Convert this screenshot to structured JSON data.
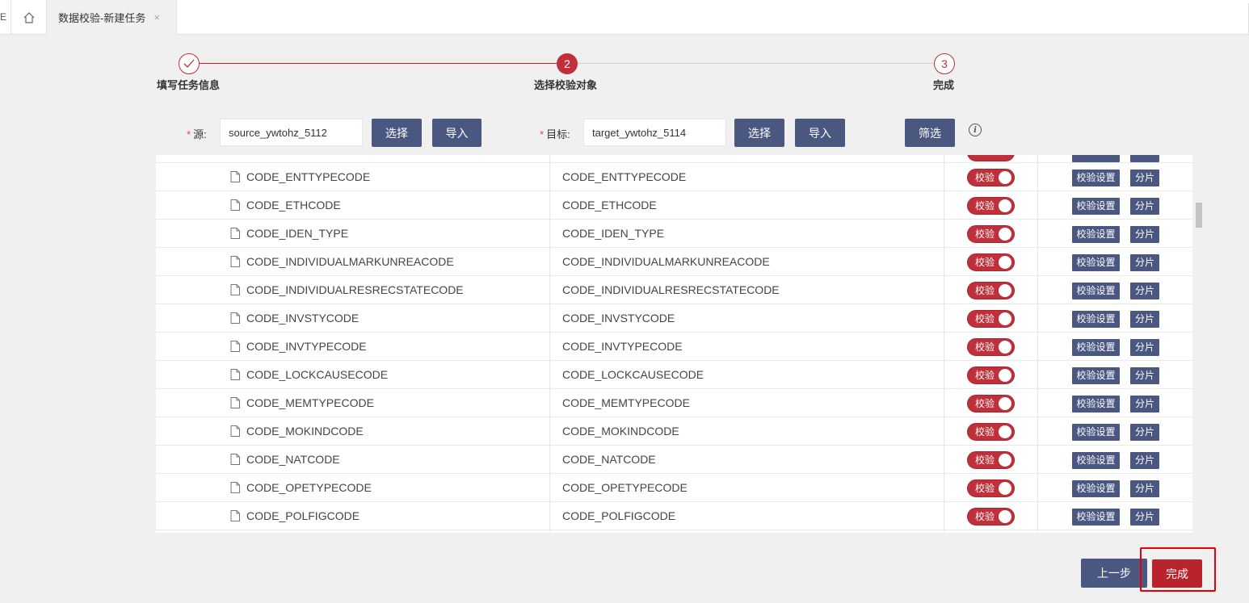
{
  "tabs": {
    "left_edge_text": "E",
    "home_icon": "home-icon",
    "active_label": "数据校验-新建任务",
    "close_glyph": "×"
  },
  "steps": [
    {
      "label": "填写任务信息",
      "marker": "✓",
      "state": "done"
    },
    {
      "label": "选择校验对象",
      "marker": "2",
      "state": "active"
    },
    {
      "label": "完成",
      "marker": "3",
      "state": "pending"
    }
  ],
  "form": {
    "source_label": "源:",
    "source_value": "source_ywtohz_5112",
    "target_label": "目标:",
    "target_value": "target_ywtohz_5114",
    "select_label": "选择",
    "import_label": "导入",
    "filter_label": "筛选",
    "required_mark": "*",
    "info_icon": "i"
  },
  "rows": [
    {
      "source": "CODE_ENTTYPECODE",
      "target": "CODE_ENTTYPECODE"
    },
    {
      "source": "CODE_ETHCODE",
      "target": "CODE_ETHCODE"
    },
    {
      "source": "CODE_IDEN_TYPE",
      "target": "CODE_IDEN_TYPE"
    },
    {
      "source": "CODE_INDIVIDUALMARKUNREACODE",
      "target": "CODE_INDIVIDUALMARKUNREACODE"
    },
    {
      "source": "CODE_INDIVIDUALRESRECSTATECODE",
      "target": "CODE_INDIVIDUALRESRECSTATECODE"
    },
    {
      "source": "CODE_INVSTYCODE",
      "target": "CODE_INVSTYCODE"
    },
    {
      "source": "CODE_INVTYPECODE",
      "target": "CODE_INVTYPECODE"
    },
    {
      "source": "CODE_LOCKCAUSECODE",
      "target": "CODE_LOCKCAUSECODE"
    },
    {
      "source": "CODE_MEMTYPECODE",
      "target": "CODE_MEMTYPECODE"
    },
    {
      "source": "CODE_MOKINDCODE",
      "target": "CODE_MOKINDCODE"
    },
    {
      "source": "CODE_NATCODE",
      "target": "CODE_NATCODE"
    },
    {
      "source": "CODE_OPETYPECODE",
      "target": "CODE_OPETYPECODE"
    },
    {
      "source": "CODE_POLFIGCODE",
      "target": "CODE_POLFIGCODE"
    }
  ],
  "row_actions": {
    "toggle_label": "校验",
    "toggle_on": true,
    "setting_label": "校验设置",
    "shard_label": "分片"
  },
  "footer": {
    "prev_label": "上一步",
    "finish_label": "完成"
  },
  "colors": {
    "accent_red": "#b8232c",
    "slate_button": "#4a5781",
    "highlight": "#e60000"
  }
}
